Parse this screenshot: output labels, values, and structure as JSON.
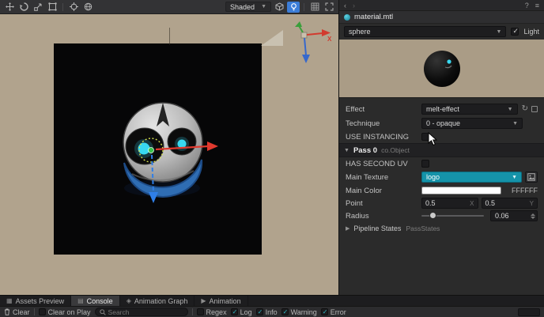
{
  "viewport": {
    "toolbar": {
      "shaded": "Shaded"
    },
    "axis": {
      "x_label": "X"
    }
  },
  "inspector": {
    "title": "material.mtl",
    "mesh_value": "sphere",
    "light_label": "Light",
    "effect_label": "Effect",
    "effect_value": "melt-effect",
    "technique_label": "Technique",
    "technique_value": "0 - opaque",
    "use_instancing_label": "USE INSTANCING",
    "pass_label": "Pass 0",
    "pass_hint": "co.Object",
    "has_second_uv_label": "HAS SECOND UV",
    "main_texture_label": "Main Texture",
    "main_texture_value": "logo",
    "main_color_label": "Main Color",
    "main_color_hex": "FFFFFF",
    "point_label": "Point",
    "point_x": "0.5",
    "point_x_suffix": "X",
    "point_y": "0.5",
    "point_y_suffix": "Y",
    "radius_label": "Radius",
    "radius_value": "0.06",
    "pipeline_label": "Pipeline States",
    "pipeline_hint": "PassStates"
  },
  "tabs": {
    "assets": "Assets Preview",
    "console": "Console",
    "graph": "Animation Graph",
    "animation": "Animation"
  },
  "console": {
    "clear": "Clear",
    "clear_on_play": "Clear on Play",
    "search_placeholder": "Search",
    "regex": "Regex",
    "log": "Log",
    "info": "Info",
    "warning": "Warning",
    "error": "Error"
  },
  "colors": {
    "accent_teal": "#1593a9",
    "active_blue": "#3b7dd8",
    "axis_x_red": "#e0392e",
    "axis_z_blue": "#2f7fe8",
    "gizmo_green": "#39c24a",
    "viewport_tan": "#b1a38d",
    "main_color_value": "#FFFFFF"
  }
}
